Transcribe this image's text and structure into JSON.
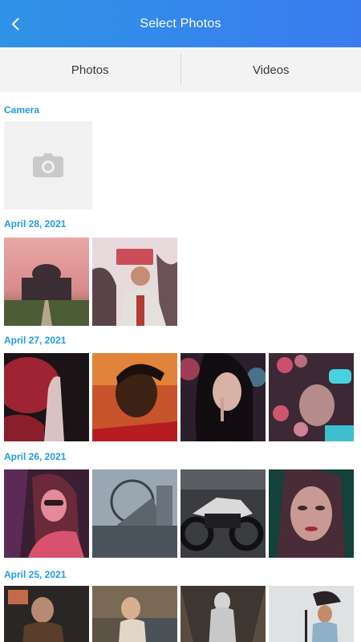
{
  "header": {
    "title": "Select Photos"
  },
  "tabs": [
    {
      "label": "Photos"
    },
    {
      "label": "Videos"
    }
  ],
  "sections": [
    {
      "label": "Camera"
    },
    {
      "label": "April 28, 2021"
    },
    {
      "label": "April 27, 2021"
    },
    {
      "label": "April 26, 2021"
    },
    {
      "label": "April 25, 2021"
    }
  ]
}
